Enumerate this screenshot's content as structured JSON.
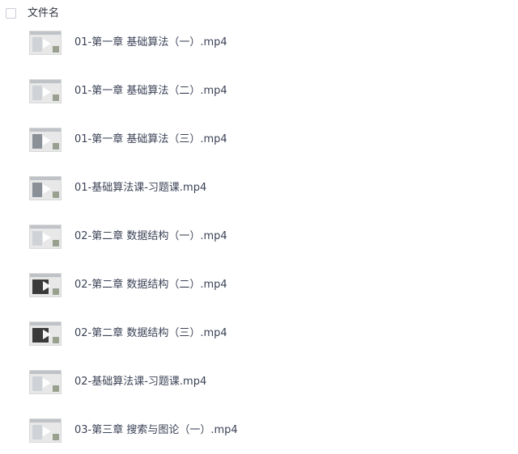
{
  "header": {
    "name_column_label": "文件名"
  },
  "files": [
    {
      "name": "01-第一章 基础算法（一）.mp4",
      "thumb_icon": "video-thumbnail-icon"
    },
    {
      "name": "01-第一章 基础算法（二）.mp4",
      "thumb_icon": "video-thumbnail-icon"
    },
    {
      "name": "01-第一章 基础算法（三）.mp4",
      "thumb_icon": "video-thumbnail-icon"
    },
    {
      "name": "01-基础算法课-习题课.mp4",
      "thumb_icon": "video-thumbnail-icon"
    },
    {
      "name": "02-第二章 数据结构（一）.mp4",
      "thumb_icon": "video-thumbnail-icon"
    },
    {
      "name": "02-第二章 数据结构（二）.mp4",
      "thumb_icon": "video-thumbnail-icon"
    },
    {
      "name": "02-第二章 数据结构（三）.mp4",
      "thumb_icon": "video-thumbnail-icon"
    },
    {
      "name": "02-基础算法课-习题课.mp4",
      "thumb_icon": "video-thumbnail-icon"
    },
    {
      "name": "03-第三章 搜索与图论（一）.mp4",
      "thumb_icon": "video-thumbnail-icon"
    }
  ]
}
